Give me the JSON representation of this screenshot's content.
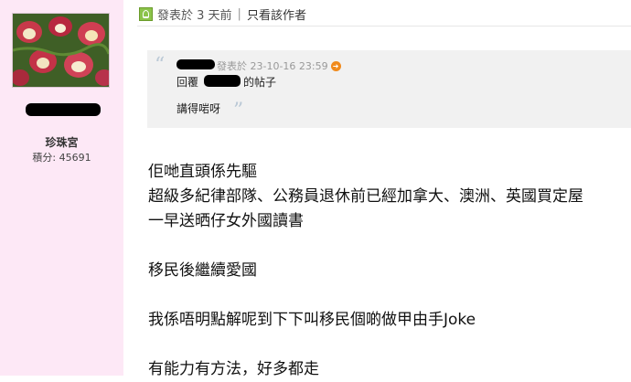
{
  "author": {
    "rank": "珍珠宮",
    "score_label": "積分: 45691"
  },
  "post": {
    "posted_label": "發表於 3 天前",
    "separator": "|",
    "only_author_label": "只看該作者"
  },
  "quote": {
    "meta": "發表於 23-10-16 23:59",
    "reply_prefix": "回覆",
    "reply_suffix": "的帖子",
    "text": "講得啱呀",
    "open_mark": "“",
    "close_mark": "”"
  },
  "body": {
    "lines": [
      "佢哋直頭係先驅",
      "超級多紀律部隊、公務員退休前已經加拿大、澳洲、英國買定屋",
      "一早送晒仔女外國讀書",
      "",
      "移民後繼續愛國",
      "",
      "我係唔明點解呢到下下叫移民個啲做甲由手Joke",
      "",
      "有能力有方法，好多都走"
    ]
  },
  "colors": {
    "sidebar_bg": "#fde8f6",
    "quote_bg": "#f1f1f1",
    "jump_icon": "#f08a1c",
    "online_icon": "#8bc34a"
  },
  "icons": {
    "online": "user-online-icon",
    "jump": "jump-to-post-icon"
  }
}
